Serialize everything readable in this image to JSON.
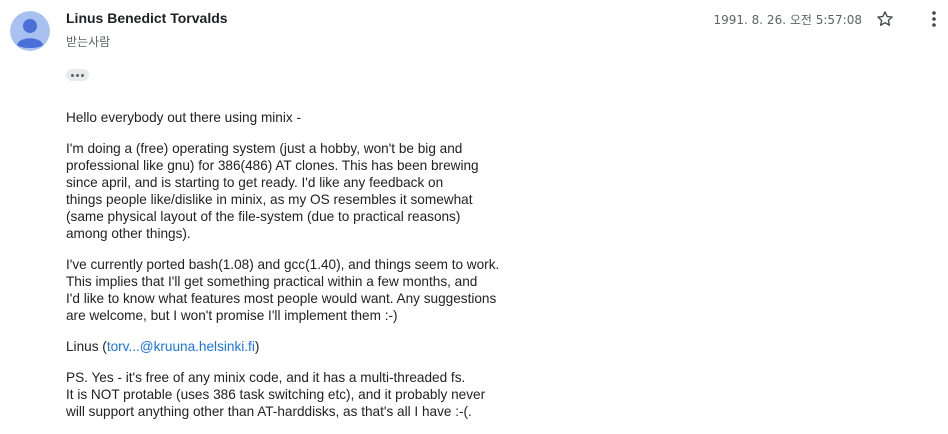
{
  "header": {
    "sender": "Linus Benedict Torvalds",
    "recipients": "받는사람",
    "date": "1991. 8. 26. 오전 5:57:08"
  },
  "icons": {
    "avatar": "avatar-icon",
    "star": "star-icon",
    "more": "more-vert-icon",
    "ellipsis": "show-trimmed-content-icon"
  },
  "colors": {
    "avatar_bg": "#a9c1f0",
    "avatar_fg": "#4a6fd9",
    "link": "#1a73e8"
  },
  "body": {
    "greeting": "Hello everybody out there using minix -",
    "para1": "I'm doing a (free) operating system (just a hobby, won't be big and\nprofessional like gnu) for 386(486) AT clones. This has been brewing\nsince april, and is starting to get ready. I'd like any feedback on\nthings people like/dislike in minix, as my OS resembles it somewhat\n(same physical layout of the file-system (due to practical reasons)\namong other things).",
    "para2": "I've currently ported bash(1.08) and gcc(1.40), and things seem to work.\nThis implies that I'll get something practical within a few months, and\nI'd like to know what features most people would want. Any suggestions\nare welcome, but I won't promise I'll implement them :-)",
    "signature_name": "Linus",
    "signature_open": " (",
    "signature_email": "torv...@kruuna.helsinki.fi",
    "signature_close": ")",
    "ps": "PS. Yes - it's free of any minix code, and it has a multi-threaded fs.\nIt is NOT protable (uses 386 task switching etc), and it probably never\nwill support anything other than AT-harddisks, as that's all I have :-(."
  }
}
